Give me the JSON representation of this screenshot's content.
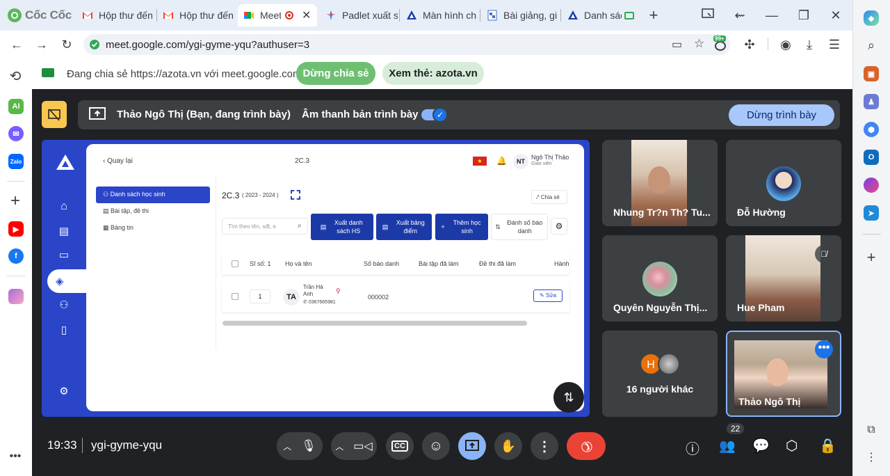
{
  "browser": {
    "brand": "Cốc Cốc",
    "tabs": [
      {
        "label": "Hộp thư đến",
        "icon": "gmail-icon"
      },
      {
        "label": "Hộp thư đến",
        "icon": "gmail-icon"
      },
      {
        "label": "Meet",
        "icon": "meet-icon",
        "active": true
      },
      {
        "label": "Padlet xuất s",
        "icon": "padlet-icon"
      },
      {
        "label": "Màn hình ch",
        "icon": "azota-icon"
      },
      {
        "label": "Bài giảng, gi",
        "icon": "doc-icon"
      },
      {
        "label": "Danh sác",
        "icon": "azota-icon"
      }
    ],
    "url": "meet.google.com/ygi-gyme-yqu?authuser=3",
    "extension_badge": "99+"
  },
  "share_bar": {
    "text": "Đang chia sẻ https://azota.vn với meet.google.com",
    "stop_label": "Dừng chia sẻ",
    "view_label": "Xem thẻ: azota.vn"
  },
  "presenter_bar": {
    "name": "Thảo Ngô Thị (Bạn, đang trình bày)",
    "audio_label": "Âm thanh bản trình bày",
    "stop_label": "Dừng trình bày"
  },
  "azota": {
    "back_label": "Quay lại",
    "class_code": "2C.3",
    "user_name": "Ngô Thị Thảo",
    "user_role": "Giáo viên",
    "user_initials": "NT",
    "nav": [
      "Danh sách học sinh",
      "Bài tập, đề thi",
      "Bảng tin"
    ],
    "class_title": "2C.3",
    "class_year": "( 2023 - 2024 )",
    "share_label": "Chia sẻ",
    "search_placeholder": "Tìm theo tên, sđt, e",
    "buttons": [
      "Xuất danh sách HS",
      "Xuất bảng điểm",
      "Thêm học sinh"
    ],
    "number_label": "Đánh số báo danh",
    "columns": [
      "Sĩ số: 1",
      "Họ và tên",
      "Số báo danh",
      "Bài tập đã làm",
      "Đề thi đã làm",
      "Hành"
    ],
    "row": {
      "index": "1",
      "initials": "TA",
      "name_line1": "Trần Hà",
      "name_line2": "Anh",
      "phone": "0367665981",
      "sbd": "000002",
      "edit_label": "Sửa"
    }
  },
  "participants": [
    {
      "name": "Nhung Tr?n Th? Tu...",
      "type": "video"
    },
    {
      "name": "Đỗ Hường",
      "type": "avatar"
    },
    {
      "name": "Quyên Nguyễn Thị...",
      "type": "avatar"
    },
    {
      "name": "Hue Pham",
      "type": "video",
      "muted": true
    },
    {
      "name": "16 người khác",
      "type": "group",
      "initial": "H"
    },
    {
      "name": "Thảo Ngô Thị",
      "type": "video",
      "self": true
    }
  ],
  "meeting": {
    "time": "19:33",
    "code": "ygi-gyme-yqu",
    "participant_count": "22"
  },
  "colors": {
    "meet_bg": "#202124",
    "tile_bg": "#3c4043",
    "accent_blue": "#8ab4f8",
    "end_call": "#ea4335",
    "azota_blue": "#2a45c8",
    "share_green": "#6fbf73"
  }
}
